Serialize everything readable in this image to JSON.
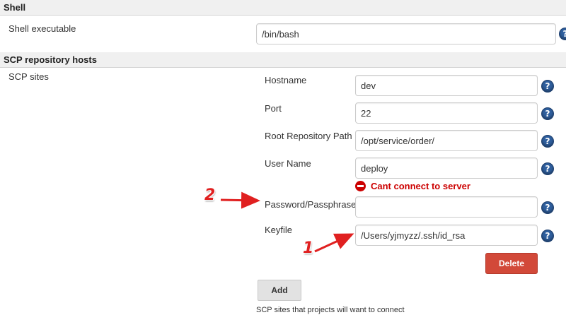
{
  "shell": {
    "section_title": "Shell",
    "executable_label": "Shell executable",
    "executable_value": "/bin/bash"
  },
  "scp": {
    "section_title": "SCP repository hosts",
    "sites_label": "SCP sites",
    "hostname_label": "Hostname",
    "hostname_value": "dev",
    "port_label": "Port",
    "port_value": "22",
    "root_path_label": "Root Repository Path",
    "root_path_value": "/opt/service/order/",
    "user_name_label": "User Name",
    "user_name_value": "deploy",
    "error_text": "Cant connect to server",
    "password_label": "Password/Passphrase",
    "password_value": "",
    "keyfile_label": "Keyfile",
    "keyfile_value": "/Users/yjmyzz/.ssh/id_rsa",
    "delete_label": "Delete",
    "add_label": "Add",
    "description": "SCP sites that projects will want to connect"
  },
  "help_glyph": "?",
  "annotations": {
    "one": "1",
    "two": "2"
  },
  "colors": {
    "error": "#cc0000",
    "delete_button": "#d24939",
    "help_icon": "#2f5f9e",
    "annotation_arrow": "#e02020"
  },
  "icons": [
    "help-icon",
    "error-icon",
    "annotation-arrow"
  ]
}
